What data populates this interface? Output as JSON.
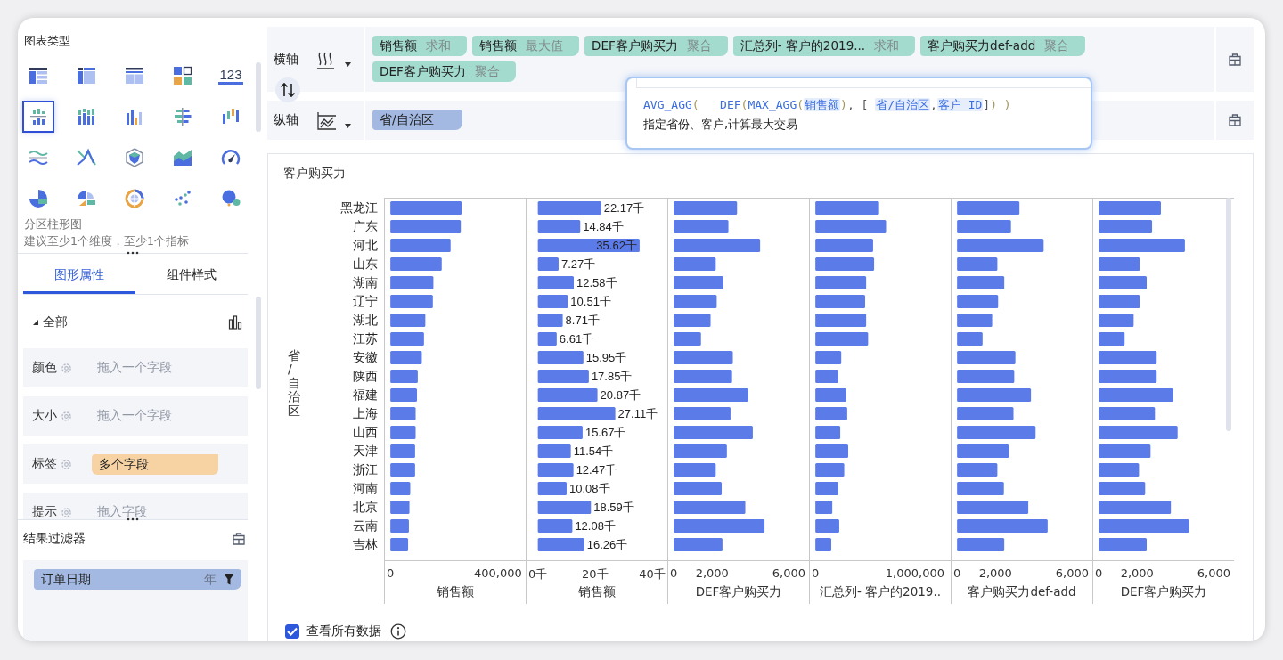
{
  "sidebar": {
    "chart_type_title": "图表类型",
    "chart_types": [
      {
        "kind": "table",
        "selected": false
      },
      {
        "kind": "cross-table",
        "selected": false
      },
      {
        "kind": "detail-table",
        "selected": false
      },
      {
        "kind": "kpi-card",
        "selected": false
      },
      {
        "kind": "number",
        "text": "123",
        "selected": false
      },
      {
        "kind": "partition-bar",
        "selected": true
      },
      {
        "kind": "stacked-bar",
        "selected": false
      },
      {
        "kind": "multi-bar",
        "selected": false
      },
      {
        "kind": "comparison-bar",
        "selected": false
      },
      {
        "kind": "range-bar",
        "selected": false
      },
      {
        "kind": "multi-line",
        "selected": false
      },
      {
        "kind": "cross-line",
        "selected": false
      },
      {
        "kind": "radar",
        "selected": false
      },
      {
        "kind": "area",
        "selected": false
      },
      {
        "kind": "gauge",
        "selected": false
      },
      {
        "kind": "pie",
        "selected": false
      },
      {
        "kind": "rose-pie",
        "selected": false
      },
      {
        "kind": "multi-pie",
        "selected": false
      },
      {
        "kind": "scatter",
        "selected": false
      },
      {
        "kind": "bubble",
        "selected": false
      }
    ],
    "chart_name": "分区柱形图",
    "chart_hint": "建议至少1个维度，至少1个指标",
    "tabs": [
      {
        "label": "图形属性",
        "selected": true
      },
      {
        "label": "组件样式",
        "selected": false
      }
    ],
    "group": {
      "label": "全部",
      "expanded": true
    },
    "properties": [
      {
        "label": "颜色",
        "placeholder": "拖入一个字段"
      },
      {
        "label": "大小",
        "placeholder": "拖入一个字段"
      },
      {
        "label": "标签",
        "value": "多个字段"
      },
      {
        "label": "提示",
        "placeholder": "拖入字段"
      }
    ],
    "filter": {
      "title": "结果过滤器",
      "items": [
        {
          "field": "订单日期",
          "granularity": "年"
        }
      ]
    }
  },
  "shelves": [
    {
      "label": "横轴",
      "pills": [
        {
          "kind": "measure",
          "field": "销售额",
          "agg": "求和"
        },
        {
          "kind": "measure",
          "field": "销售额",
          "agg": "最大值"
        },
        {
          "kind": "measure",
          "field": "DEF客户购买力",
          "agg": "聚合"
        },
        {
          "kind": "measure",
          "field": "汇总列- 客户的2019...",
          "agg": "求和"
        },
        {
          "kind": "measure",
          "field": "客户购买力def-add",
          "agg": "聚合"
        },
        {
          "kind": "measure",
          "field": "DEF客户购买力",
          "agg": "聚合"
        }
      ]
    },
    {
      "label": "纵轴",
      "pills": [
        {
          "kind": "dimension",
          "field": "省/自治区"
        }
      ]
    }
  ],
  "formula": {
    "tokens": [
      {
        "kind": "func",
        "text": "AVG_AGG"
      },
      {
        "kind": "paren",
        "text": "(   "
      },
      {
        "kind": "func",
        "text": "DEF"
      },
      {
        "kind": "paren",
        "text": "("
      },
      {
        "kind": "func",
        "text": "MAX_AGG"
      },
      {
        "kind": "paren",
        "text": "("
      },
      {
        "kind": "field",
        "text": "销售额"
      },
      {
        "kind": "paren",
        "text": ")"
      },
      {
        "kind": "punct",
        "text": ", [ "
      },
      {
        "kind": "field",
        "text": "省/自治区"
      },
      {
        "kind": "punct",
        "text": ","
      },
      {
        "kind": "field",
        "text": "客户 ID"
      },
      {
        "kind": "punct",
        "text": "]"
      },
      {
        "kind": "paren",
        "text": ") )"
      }
    ],
    "description": "指定省份、客户,计算最大交易"
  },
  "chart": {
    "title": "客户购买力",
    "ylabel": "省/自治区",
    "categories": [
      "黑龙江",
      "广东",
      "河北",
      "山东",
      "湖南",
      "辽宁",
      "湖北",
      "江苏",
      "安徽",
      "陕西",
      "福建",
      "上海",
      "山西",
      "天津",
      "浙江",
      "河南",
      "北京",
      "云南",
      "吉林"
    ],
    "panels": [
      {
        "chart_data": {
          "type": "bar",
          "orientation": "horizontal",
          "xlabel": "销售额",
          "xlim": [
            0,
            500000
          ],
          "xticks": [
            {
              "value": 0,
              "label": "0"
            },
            {
              "value": 400000,
              "label": "400,000"
            }
          ],
          "series": [
            {
              "color": "#5b7be8",
              "values": [
                265000,
                262000,
                224000,
                191000,
                160000,
                158000,
                130000,
                125000,
                117000,
                102000,
                99000,
                94000,
                94000,
                92000,
                92000,
                74000,
                71000,
                69000,
                66000
              ]
            }
          ]
        }
      },
      {
        "chart_data": {
          "type": "bar",
          "orientation": "horizontal",
          "xlabel": "销售额",
          "xlim": [
            0,
            45
          ],
          "xticks": [
            {
              "value": 0,
              "label": "0千"
            },
            {
              "value": 20,
              "label": "20千"
            },
            {
              "value": 40,
              "label": "40千"
            }
          ],
          "series": [
            {
              "color": "#5b7be8",
              "values": [
                22.17,
                14.84,
                35.62,
                7.27,
                12.58,
                10.51,
                8.71,
                6.61,
                15.95,
                17.85,
                20.87,
                27.11,
                15.67,
                11.54,
                12.47,
                10.08,
                18.59,
                12.08,
                16.26
              ]
            }
          ],
          "value_labels": [
            "22.17千",
            "14.84千",
            "35.62千",
            "7.27千",
            "12.58千",
            "10.51千",
            "8.71千",
            "6.61千",
            "15.95千",
            "17.85千",
            "20.87千",
            "27.11千",
            "15.67千",
            "11.54千",
            "12.47千",
            "10.08千",
            "18.59千",
            "12.08千",
            "16.26千"
          ]
        }
      },
      {
        "chart_data": {
          "type": "bar",
          "orientation": "horizontal",
          "xlabel": "DEF客户购买力",
          "xlim": [
            0,
            7000
          ],
          "xticks": [
            {
              "value": 0,
              "label": "0"
            },
            {
              "value": 2000,
              "label": "2,000"
            },
            {
              "value": 6000,
              "label": "6,000"
            }
          ],
          "series": [
            {
              "color": "#5b7be8",
              "values": [
                3300,
                2850,
                4500,
                2190,
                2580,
                2240,
                1920,
                1420,
                3080,
                3040,
                3880,
                2960,
                4120,
                2770,
                2190,
                2500,
                3730,
                4730,
                2540
              ]
            }
          ]
        }
      },
      {
        "chart_data": {
          "type": "bar",
          "orientation": "horizontal",
          "xlabel": "汇总列- 客户的2019..",
          "xlim": [
            0,
            1350000
          ],
          "xticks": [
            {
              "value": 0,
              "label": "0"
            },
            {
              "value": 1000000,
              "label": "1,000,000"
            }
          ],
          "series": [
            {
              "color": "#5b7be8",
              "values": [
                640000,
                710000,
                580000,
                590000,
                510000,
                500000,
                510000,
                530000,
                260000,
                230000,
                310000,
                320000,
                250000,
                330000,
                290000,
                230000,
                170000,
                240000,
                160000
              ]
            }
          ]
        }
      },
      {
        "chart_data": {
          "type": "bar",
          "orientation": "horizontal",
          "xlabel": "客户购买力def-add",
          "xlim": [
            0,
            7000
          ],
          "xticks": [
            {
              "value": 0,
              "label": "0"
            },
            {
              "value": 2000,
              "label": "2,000"
            },
            {
              "value": 6000,
              "label": "6,000"
            }
          ],
          "series": [
            {
              "color": "#5b7be8",
              "values": [
                3250,
                2810,
                4510,
                2100,
                2460,
                2140,
                1830,
                1330,
                3040,
                2980,
                3850,
                2940,
                4090,
                2700,
                2100,
                2440,
                3710,
                4720,
                2460
              ]
            }
          ]
        }
      },
      {
        "chart_data": {
          "type": "bar",
          "orientation": "horizontal",
          "xlabel": "DEF客户购买力",
          "xlim": [
            0,
            7000
          ],
          "xticks": [
            {
              "value": 0,
              "label": "0"
            },
            {
              "value": 2000,
              "label": "2,000"
            },
            {
              "value": 6000,
              "label": "6,000"
            }
          ],
          "series": [
            {
              "color": "#5b7be8",
              "values": [
                3240,
                2780,
                4490,
                2140,
                2500,
                2140,
                1820,
                1350,
                3020,
                3020,
                3880,
                2930,
                4110,
                2700,
                2100,
                2420,
                3760,
                4710,
                2500
              ]
            }
          ]
        }
      }
    ]
  },
  "view_all": {
    "label": "查看所有数据",
    "checked": true
  }
}
